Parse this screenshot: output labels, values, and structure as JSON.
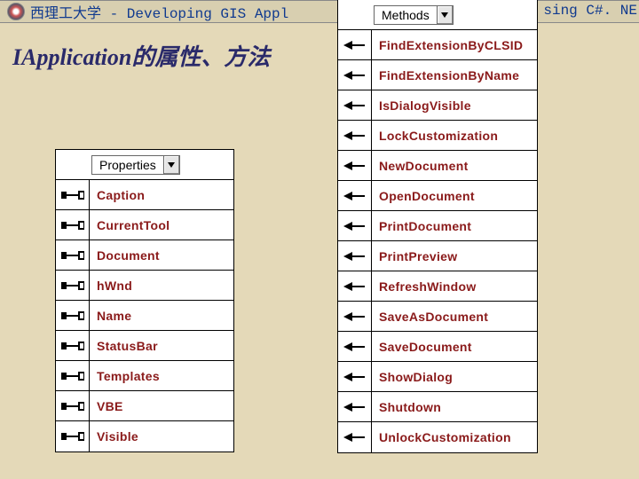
{
  "header": {
    "text_left": "西理工大学 - Developing GIS Appl",
    "text_right": "sing C#. NE"
  },
  "subtitle": "IApplication的属性、方法",
  "properties": {
    "selector_label": "Properties",
    "items": [
      "Caption",
      "CurrentTool",
      "Document",
      "hWnd",
      "Name",
      "StatusBar",
      "Templates",
      "VBE",
      "Visible"
    ]
  },
  "methods": {
    "selector_label": "Methods",
    "items": [
      "FindExtensionByCLSID",
      "FindExtensionByName",
      "IsDialogVisible",
      "LockCustomization",
      "NewDocument",
      "OpenDocument",
      "PrintDocument",
      "PrintPreview",
      "RefreshWindow",
      "SaveAsDocument",
      "SaveDocument",
      "ShowDialog",
      "Shutdown",
      "UnlockCustomization"
    ]
  }
}
